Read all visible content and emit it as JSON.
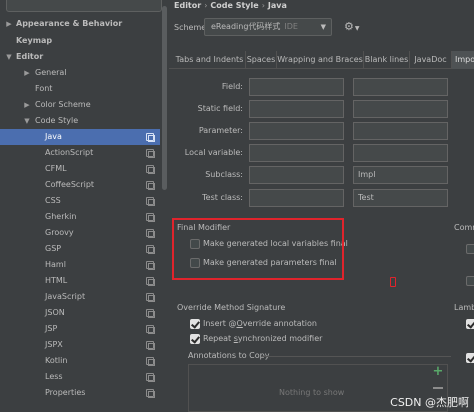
{
  "tree": {
    "items": [
      {
        "label": "Appearance & Behavior",
        "arrow": "▶"
      },
      {
        "label": "Keymap",
        "arrow": ""
      },
      {
        "label": "Editor",
        "arrow": "▼"
      },
      {
        "label": "General",
        "arrow": "▶"
      },
      {
        "label": "Font",
        "arrow": ""
      },
      {
        "label": "Color Scheme",
        "arrow": "▶"
      },
      {
        "label": "Code Style",
        "arrow": "▼"
      },
      {
        "label": "Java",
        "arrow": ""
      },
      {
        "label": "ActionScript",
        "arrow": ""
      },
      {
        "label": "CFML",
        "arrow": ""
      },
      {
        "label": "CoffeeScript",
        "arrow": ""
      },
      {
        "label": "CSS",
        "arrow": ""
      },
      {
        "label": "Gherkin",
        "arrow": ""
      },
      {
        "label": "Groovy",
        "arrow": ""
      },
      {
        "label": "GSP",
        "arrow": ""
      },
      {
        "label": "Haml",
        "arrow": ""
      },
      {
        "label": "HTML",
        "arrow": ""
      },
      {
        "label": "JavaScript",
        "arrow": ""
      },
      {
        "label": "JSON",
        "arrow": ""
      },
      {
        "label": "JSP",
        "arrow": ""
      },
      {
        "label": "JSPX",
        "arrow": ""
      },
      {
        "label": "Kotlin",
        "arrow": ""
      },
      {
        "label": "Less",
        "arrow": ""
      },
      {
        "label": "Properties",
        "arrow": ""
      }
    ]
  },
  "breadcrumb": {
    "part1": "Editor",
    "sep": "›",
    "part2": "Code Style",
    "part3": "Java"
  },
  "scheme": {
    "label": "Scheme:",
    "value": "eReading代码样式",
    "suffix": "IDE",
    "dropdown": "▼"
  },
  "gear": {
    "icon": "⚙",
    "dropdown": "▼"
  },
  "tabs": [
    "Tabs and Indents",
    "Spaces",
    "Wrapping and Braces",
    "Blank lines",
    "JavaDoc",
    "Impo"
  ],
  "naming": {
    "rows": [
      {
        "label": "Field:",
        "prefix": "",
        "suffix": ""
      },
      {
        "label": "Static field:",
        "prefix": "",
        "suffix": ""
      },
      {
        "label": "Parameter:",
        "prefix": "",
        "suffix": ""
      },
      {
        "label": "Local variable:",
        "prefix": "",
        "suffix": ""
      },
      {
        "label": "Subclass:",
        "prefix": "",
        "suffix": "Impl"
      },
      {
        "label": "Test class:",
        "prefix": "",
        "suffix": "Test"
      }
    ]
  },
  "final_modifier": {
    "title": "Final Modifier",
    "options": [
      {
        "label": "Make generated local variables final",
        "checked": false
      },
      {
        "label": "Make generated parameters final",
        "checked": false
      }
    ]
  },
  "override": {
    "title": "Override Method Signature",
    "insert_pre": "Insert @",
    "insert_u": "O",
    "insert_post": "verride annotation",
    "insert_checked": true,
    "repeat_pre": "Repeat ",
    "repeat_u": "s",
    "repeat_post": "ynchronized modifier",
    "repeat_checked": true
  },
  "annotations": {
    "title": "Annotations to Copy",
    "empty_text": "Nothing to show",
    "add": "+"
  },
  "edge": {
    "comm": "Comm",
    "lamb": "Lamb"
  },
  "watermark": "CSDN @杰肥啊",
  "colors": {
    "selection": "#4b6eaf",
    "highlight": "#e0242c",
    "add": "#59a869"
  }
}
